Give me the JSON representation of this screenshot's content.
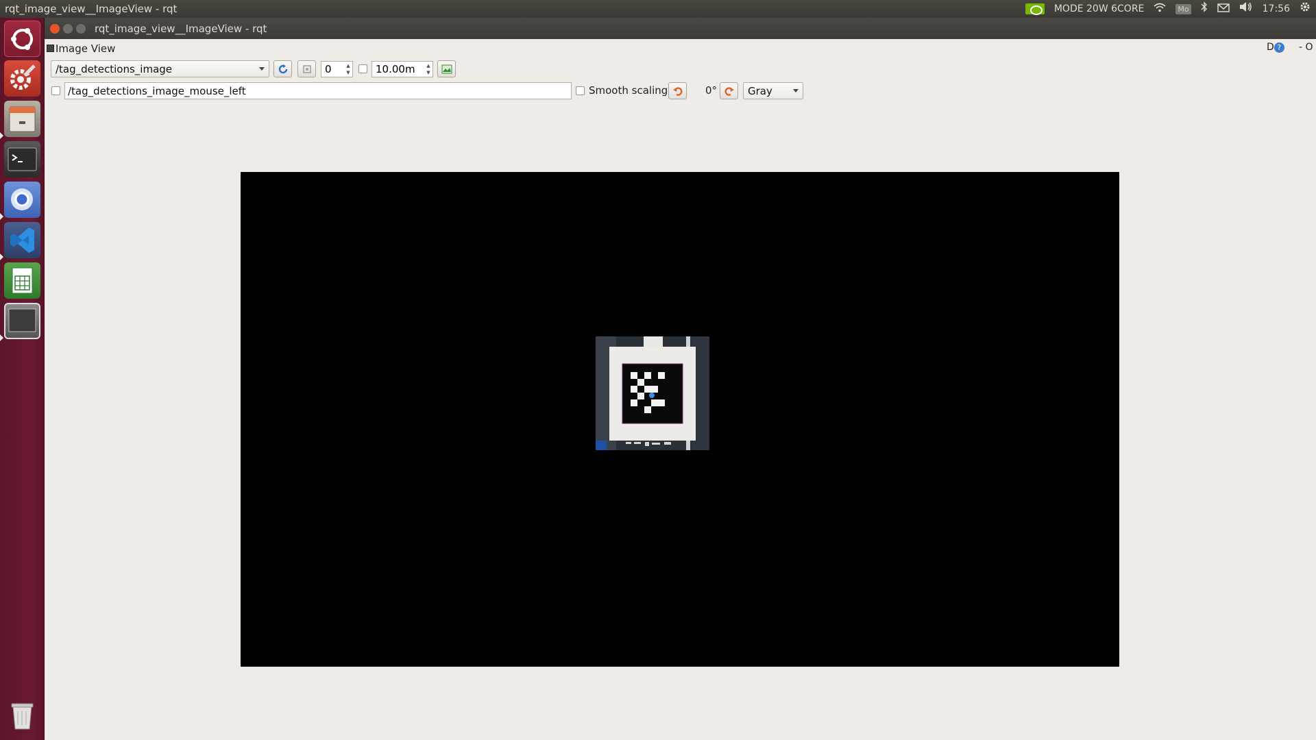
{
  "top_panel": {
    "title": "rqt_image_view__ImageView - rqt",
    "mode_label": "MODE 20W 6CORE",
    "keyboard_indicator": "Mo",
    "clock": "17:56"
  },
  "window": {
    "title": "rqt_image_view__ImageView - rqt"
  },
  "plugin": {
    "title": "Image View",
    "help_label": "D",
    "corner_controls": "- O"
  },
  "toolbar": {
    "topic": "/tag_detections_image",
    "spin_value": "0",
    "max_range": "10.00m",
    "mouse_topic": "/tag_detections_image_mouse_left",
    "smooth_scaling_label": "Smooth scaling",
    "rotation": "0°",
    "color_scheme": "Gray"
  },
  "colors": {
    "launcher": "#6a1a30",
    "panel": "#3d3c38",
    "window_bg": "#efebe7",
    "close_button": "#e9542e",
    "refresh_blue": "#2f6fc0",
    "nvidia_green": "#76b900"
  },
  "launcher_icons": [
    "ubuntu-dash-icon",
    "system-settings-icon",
    "file-cabinet-icon",
    "terminal-icon",
    "chromium-icon",
    "vscode-icon",
    "spreadsheet-icon",
    "window-icon",
    "trash-icon"
  ]
}
